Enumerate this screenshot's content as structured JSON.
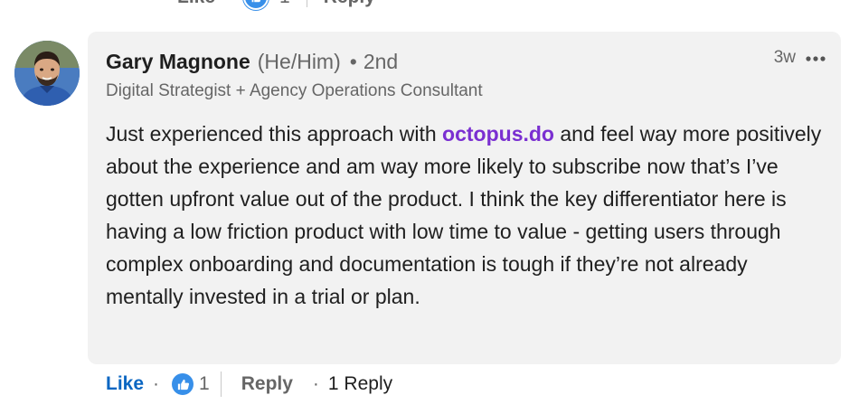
{
  "top_actions": {
    "like_label": "Like",
    "dot": "·",
    "reaction_count": "1",
    "reply_label": "Reply"
  },
  "comment": {
    "author": {
      "name": "Gary Magnone",
      "pronouns": "(He/Him)",
      "separator": "•",
      "degree": "2nd",
      "headline": "Digital Strategist + Agency Operations Consultant"
    },
    "time": "3w",
    "more_icon": "ellipsis-icon",
    "text_before_link": "Just experienced this approach with ",
    "link_text": "octopus.do",
    "text_after_link": " and feel way more positively about the experience and am way more likely to subscribe now that’s I’ve gotten upfront value out of the product. I think the key differentiator here is having a low friction product with low time to value - getting users through complex onboarding and documentation is tough if they’re not already mentally invested in a trial or plan."
  },
  "actions": {
    "like_label": "Like",
    "dot": "·",
    "reaction_icon": "thumbs-up-icon",
    "reaction_count": "1",
    "reply_label": "Reply",
    "replies_label": "1 Reply"
  },
  "colors": {
    "accent": "#0a66c2",
    "link": "#7a2fd1",
    "bubble_bg": "#f2f2f2",
    "reaction_blue": "#378fe9",
    "muted_text": "#666666"
  }
}
